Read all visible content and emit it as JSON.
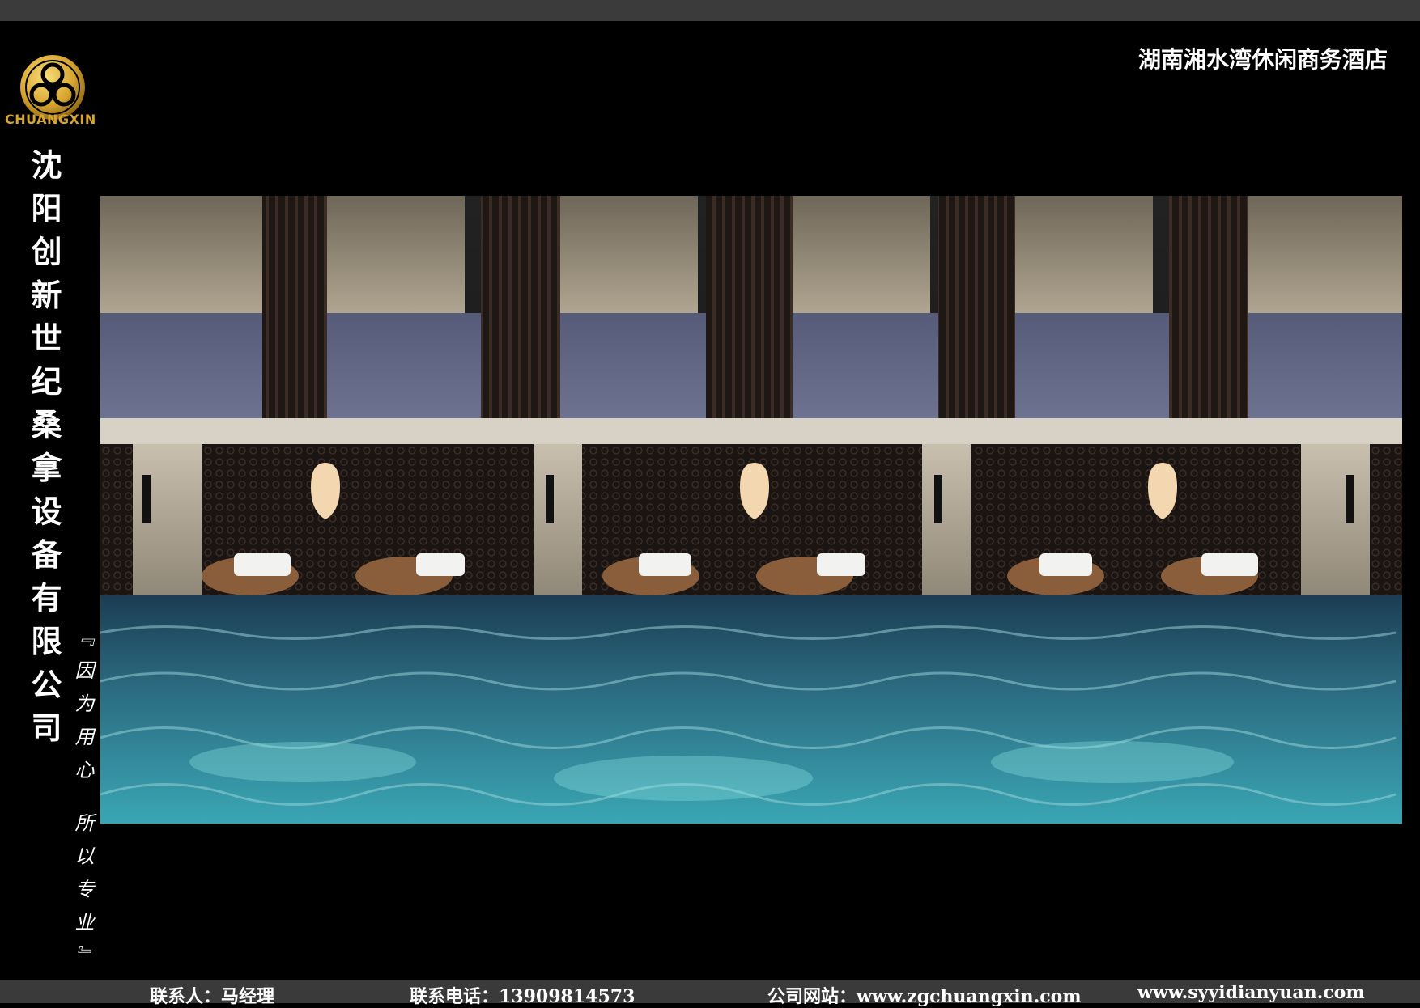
{
  "hotel_name": "湖南湘水湾休闲商务酒店",
  "company_name": "沈阳创新世纪桑拿设备有限公司",
  "logo_text": "CHUANGXIN",
  "slogan": "『因为用心  所以专业』",
  "footer": {
    "contact": "联系人：马经理",
    "phone": "联系电话：13909814573",
    "website1": "公司网站：www.zgchuangxin.com",
    "website2": "www.syyidianyuan.com"
  },
  "colors": {
    "logo_gold": "#d7a531",
    "background": "#000000",
    "bars": "#3b3b3b"
  }
}
